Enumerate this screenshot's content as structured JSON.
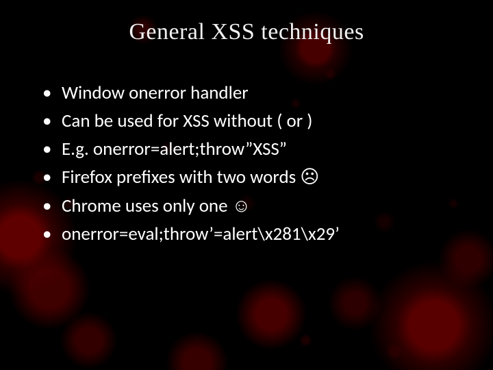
{
  "title": "General XSS techniques",
  "bullets": [
    "Window onerror handler",
    "Can be used for XSS without ( or )",
    "E.g. onerror=alert;throw”XSS”",
    "Firefox prefixes with two words ☹",
    "Chrome uses only one ☺",
    "onerror=eval;throw’=alert\\x281\\x29’"
  ]
}
